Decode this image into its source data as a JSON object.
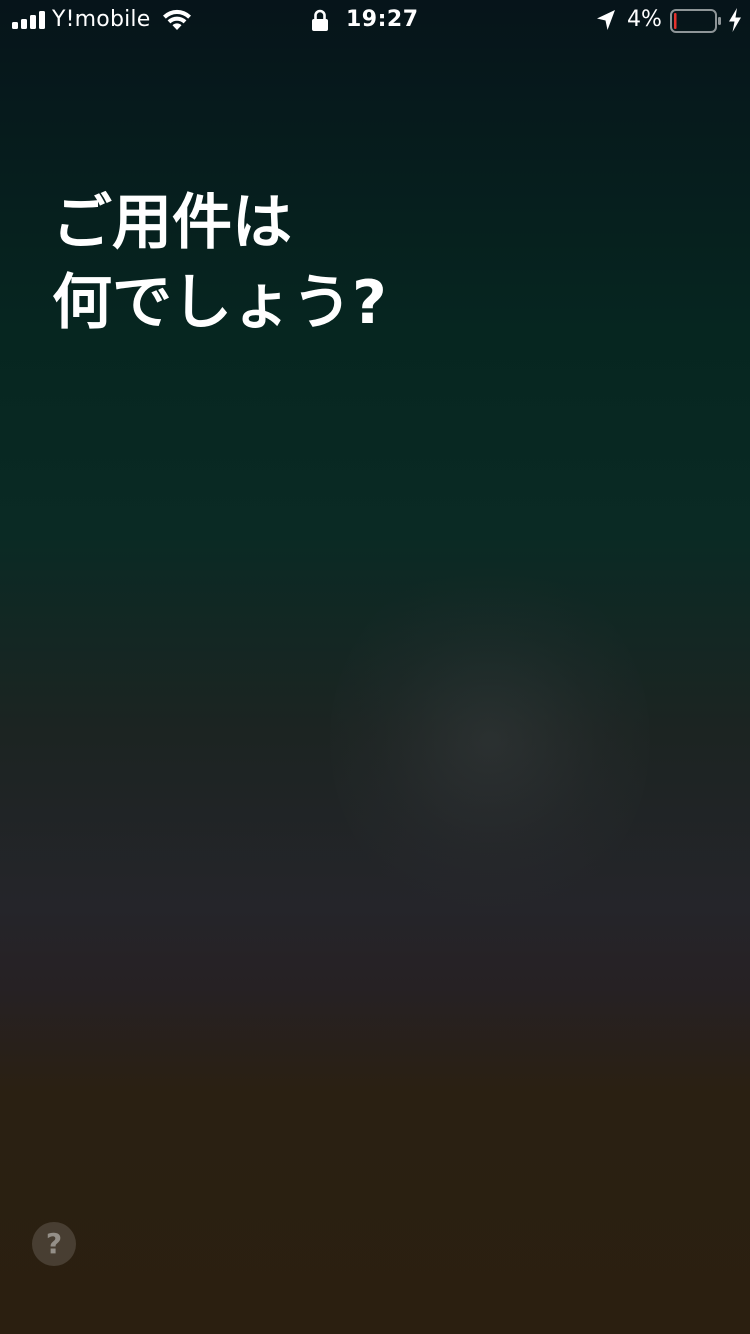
{
  "status_bar": {
    "carrier": "Y!mobile",
    "time": "19:27",
    "battery_percent": "4%",
    "battery_level": 0.04,
    "icons": [
      "signal-icon",
      "wifi-icon",
      "lock-icon",
      "location-icon",
      "battery-icon",
      "charging-bolt-icon"
    ]
  },
  "siri": {
    "prompt_line1": "ご用件は",
    "prompt_line2": "何でしょう?",
    "help_label": "?"
  },
  "colors": {
    "battery_low": "#e5322d",
    "text": "#ffffff"
  }
}
